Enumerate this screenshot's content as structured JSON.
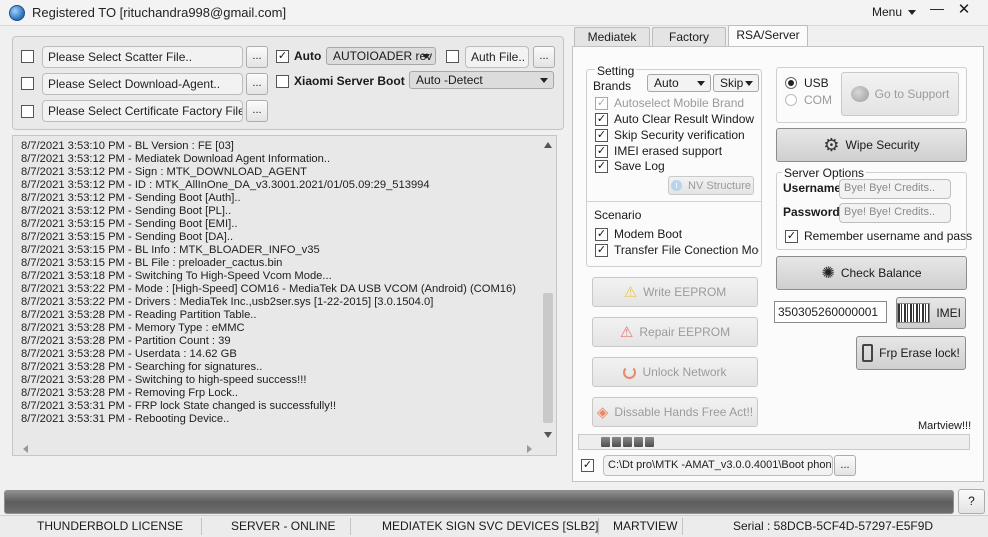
{
  "window": {
    "title": "Registered TO [rituchandra998@gmail.com]",
    "menu_label": "Menu",
    "minimize_glyph": "—",
    "close_glyph": "✕"
  },
  "top_panel": {
    "scatter_placeholder": "Please Select Scatter File..",
    "download_agent_placeholder": "Please Select Download-Agent..",
    "certificate_placeholder": "Please Select Certificate Factory File..",
    "browse_label": "...",
    "auto_label": "Auto",
    "auto_checked": true,
    "auto_combo_value": "AUTOIOADER rev",
    "auth_file_placeholder": "Auth File..",
    "xiaomi_label": "Xiaomi Server Boot",
    "xiaomi_combo_value": "Auto -Detect"
  },
  "log": {
    "lines": [
      "8/7/2021 3:53:10 PM - BL Version : FE [03]",
      "8/7/2021 3:53:12 PM - Mediatek Download Agent Information..",
      "8/7/2021 3:53:12 PM - Sign : MTK_DOWNLOAD_AGENT",
      "8/7/2021 3:53:12 PM - ID : MTK_AllInOne_DA_v3.3001.2021/01/05.09:29_513994",
      "8/7/2021 3:53:12 PM - Sending Boot [Auth]..",
      "8/7/2021 3:53:12 PM - Sending Boot [PL]..",
      "8/7/2021 3:53:15 PM - Sending Boot [EMI]..",
      "8/7/2021 3:53:15 PM - Sending Boot [DA]..",
      "8/7/2021 3:53:15 PM - BL Info : MTK_BLOADER_INFO_v35",
      "8/7/2021 3:53:15 PM - BL File : preloader_cactus.bin",
      "8/7/2021 3:53:18 PM - Switching To High-Speed Vcom Mode...",
      "8/7/2021 3:53:22 PM - Mode : [High-Speed] COM16 - MediaTek DA USB VCOM (Android) (COM16)",
      "8/7/2021 3:53:22 PM - Drivers : MediaTek Inc.,usb2ser.sys [1-22-2015] [3.0.1504.0]",
      "8/7/2021 3:53:28 PM - Reading Partition Table..",
      "8/7/2021 3:53:28 PM - Memory Type : eMMC",
      "8/7/2021 3:53:28 PM - Partition Count : 39",
      "8/7/2021 3:53:28 PM - Userdata : 14.62 GB",
      "8/7/2021 3:53:28 PM - Searching for signatures..",
      "8/7/2021 3:53:28 PM - Switching to high-speed success!!!",
      "8/7/2021 3:53:28 PM - Removing Frp Lock..",
      "8/7/2021 3:53:31 PM - FRP lock State changed is successfully!!",
      "8/7/2021 3:53:31 PM - Rebooting Device.."
    ]
  },
  "tabs": [
    {
      "label": "Mediatek",
      "active": false
    },
    {
      "label": "Factory",
      "active": false
    },
    {
      "label": "RSA/Server",
      "active": true
    }
  ],
  "setting": {
    "title_line1": "Setting",
    "title_line2": "Brands",
    "brand_combo": "Auto",
    "skip_combo": "Skip",
    "options": [
      {
        "label": "Autoselect Mobile Brand",
        "checked": true,
        "disabled": true
      },
      {
        "label": "Auto Clear Result Window",
        "checked": true,
        "disabled": false
      },
      {
        "label": "Skip Security verification",
        "checked": true,
        "disabled": false
      },
      {
        "label": "IMEI erased support",
        "checked": true,
        "disabled": false
      },
      {
        "label": "Save Log",
        "checked": true,
        "disabled": false
      }
    ],
    "nv_structure_label": "NV Structure",
    "scenario_label": "Scenario",
    "scenario_options": [
      {
        "label": "Modem Boot",
        "checked": true
      },
      {
        "label": "Transfer File Conection Mod",
        "checked": true
      }
    ]
  },
  "actions": {
    "write_eeprom": "Write EEPROM",
    "repair_eeprom": "Repair EEPROM",
    "unlock_network": "Unlock Network",
    "disable_hands_free": "Dissable Hands Free Act!!"
  },
  "connection": {
    "usb_label": "USB",
    "com_label": "COM",
    "usb_selected": true,
    "go_support_label": "Go to Support"
  },
  "wipe_security_label": "Wipe Security",
  "server_options": {
    "title": "Server Options",
    "username_label": "Username",
    "username_placeholder": "Bye! Bye! Credits..",
    "password_label": "Password",
    "password_placeholder": "Bye! Bye! Credits..",
    "remember_label": "Remember username and pass",
    "remember_checked": true
  },
  "check_balance_label": "Check Balance",
  "imei": {
    "value": "350305260000001",
    "button_label": "IMEI"
  },
  "frp_erase_label": "Frp Erase lock!",
  "martview_label": "Martview!!!",
  "mini_progress_segments": 5,
  "boot_path": {
    "checked": true,
    "value": "C:\\Dt pro\\MTK -AMAT_v3.0.0.4001\\Boot phon",
    "browse_label": "..."
  },
  "help_label": "?",
  "status_bar": [
    "THUNDERBOLD LICENSE",
    "SERVER - ONLINE",
    "MEDIATEK SIGN SVC DEVICES [SLB2]",
    "MARTVIEW",
    "Serial : 58DCB-5CF4D-57297-E5F9D"
  ]
}
